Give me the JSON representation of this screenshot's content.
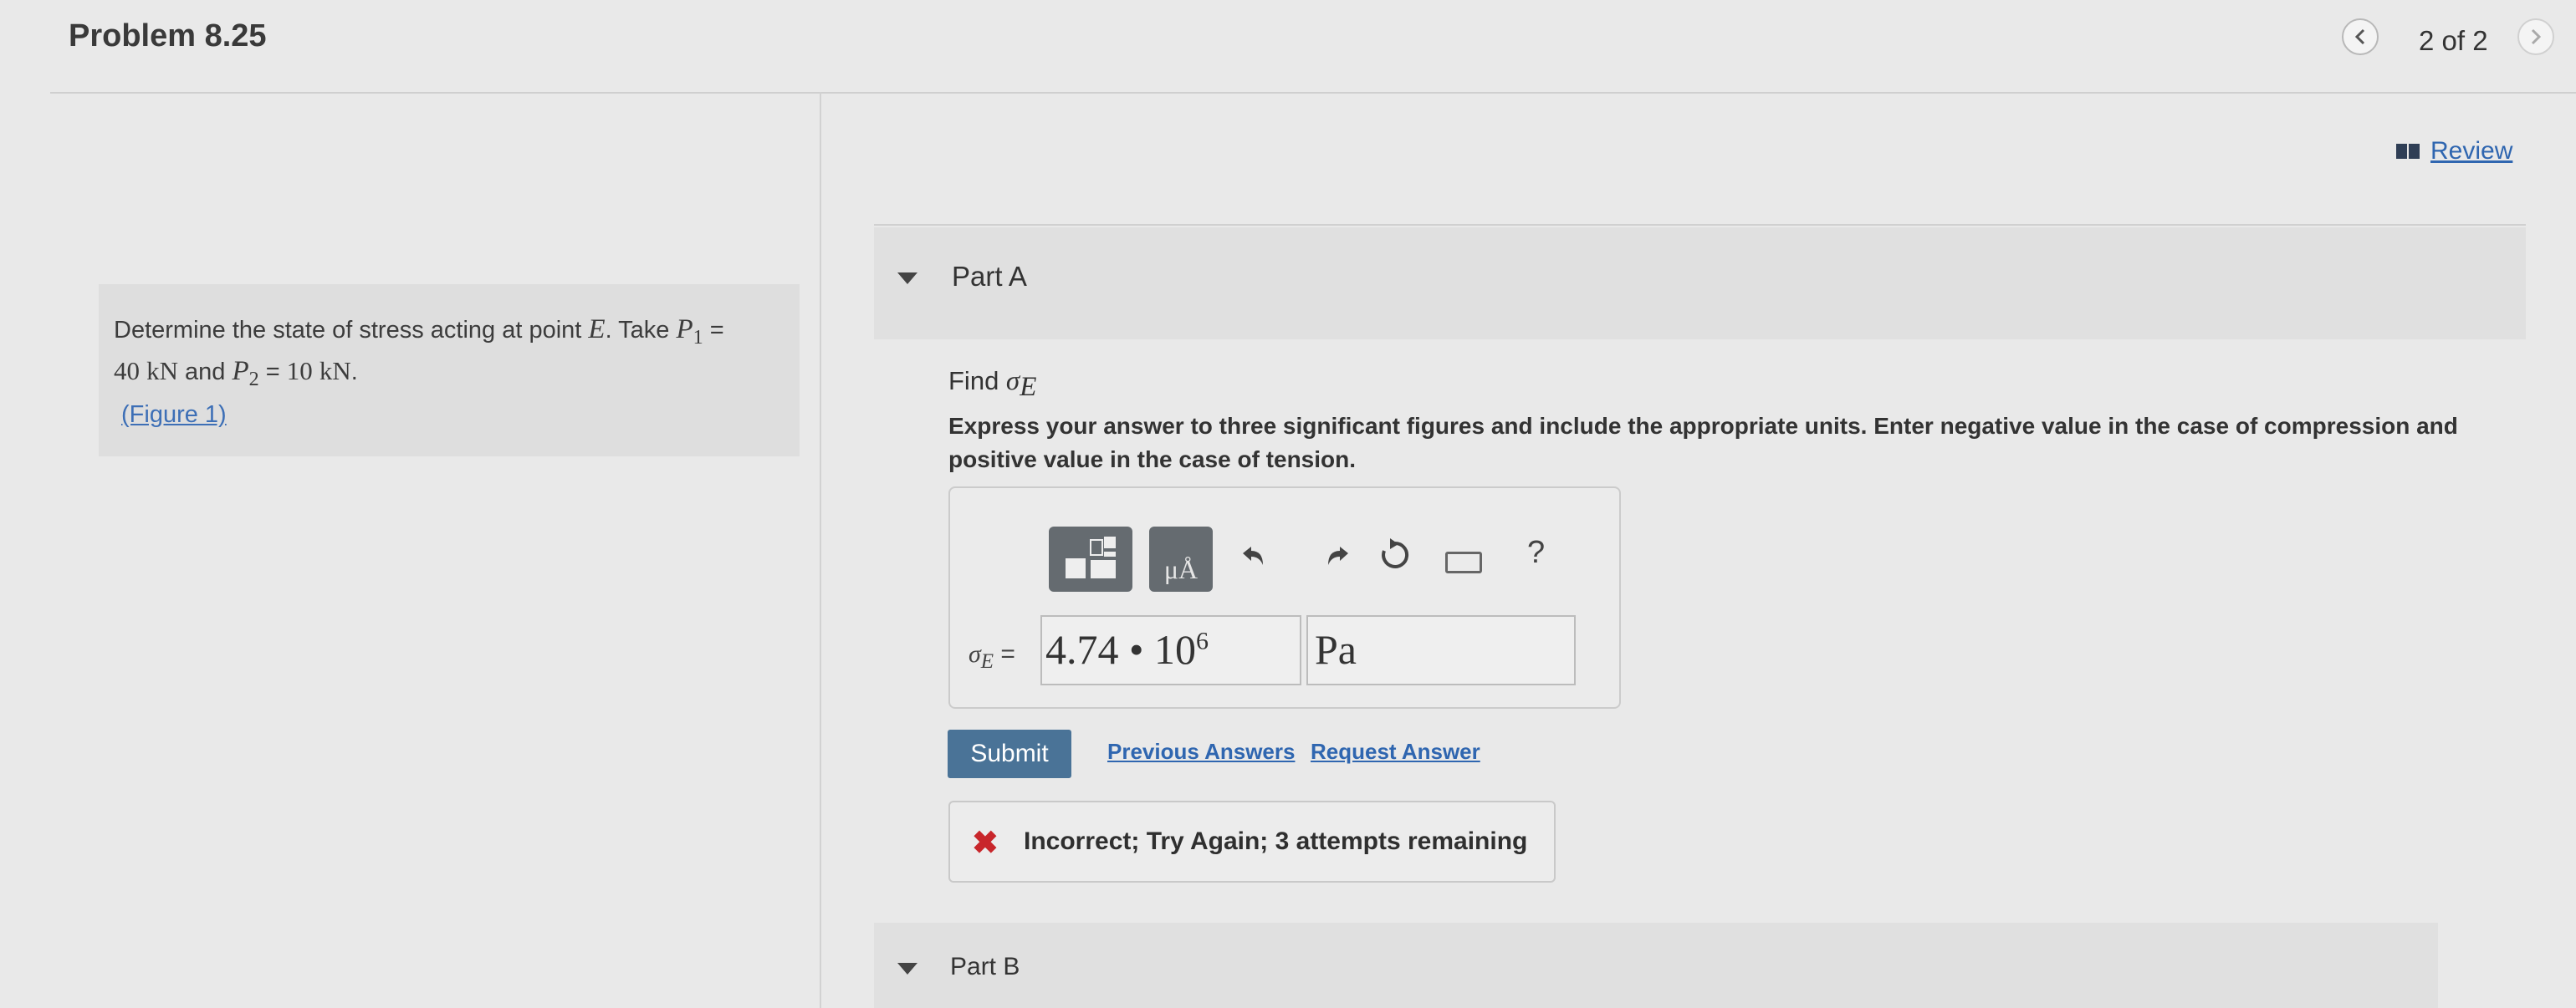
{
  "header": {
    "title": "Problem 8.25",
    "pagination": "2 of 2",
    "prev_icon": "chevron-left-icon",
    "next_icon": "chevron-right-icon"
  },
  "problem": {
    "text_prefix": "Determine the state of stress acting at point ",
    "point": "E",
    "text_take": ". Take ",
    "p1_symbol": "P",
    "p1_sub": "1",
    "equals": " = ",
    "p1_value": "40",
    "unit_kn": "kN",
    "and_text": " and ",
    "p2_symbol": "P",
    "p2_sub": "2",
    "p2_value": "10",
    "period": ".",
    "figure_link": "(Figure 1)"
  },
  "review": {
    "label": "Review",
    "icon": "book-icon"
  },
  "part_a": {
    "title": "Part A",
    "find_text": "Find ",
    "sigma": "σ",
    "sigma_sub": "E",
    "instructions": "Express your answer to three significant figures and include the appropriate units. Enter negative value in the case of compression and positive value in the case of tension.",
    "toolbar": {
      "units_label": "μÅ",
      "help_label": "?",
      "undo_icon": "undo-icon",
      "redo_icon": "redo-icon",
      "reset_icon": "reset-icon",
      "keyboard_icon": "keyboard-icon"
    },
    "answer_label_eq": " =",
    "value_mantissa": "4.74",
    "value_dot": " • ",
    "value_base": "10",
    "value_exp": "6",
    "unit": "Pa",
    "submit_label": "Submit",
    "previous_answers_label": "Previous Answers",
    "request_answer_label": "Request Answer",
    "feedback": "Incorrect; Try Again; 3 attempts remaining",
    "feedback_icon": "x-icon",
    "colors": {
      "submit": "#4a7397",
      "link": "#2f66b0",
      "error": "#c8262b"
    }
  },
  "part_b": {
    "title": "Part B"
  }
}
